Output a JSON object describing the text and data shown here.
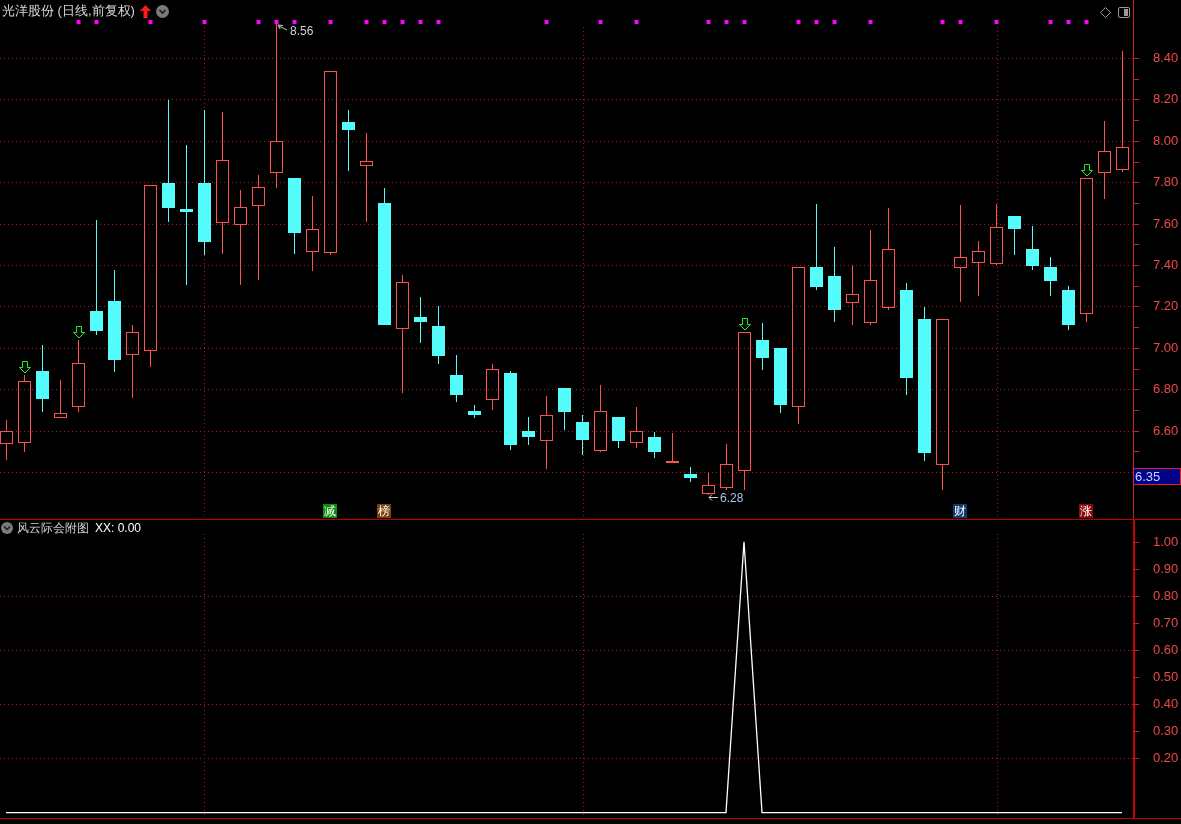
{
  "main_chart": {
    "title": "光洋股份 (日线,前复权)",
    "high_mark": "8.56",
    "low_mark": "6.28",
    "price_labels": [
      "8.40",
      "8.20",
      "8.00",
      "7.80",
      "7.60",
      "7.40",
      "7.20",
      "7.00",
      "6.80",
      "6.60"
    ],
    "current_price": "6.35",
    "event_tags": [
      {
        "label": "减",
        "color": "#108c10"
      },
      {
        "label": "榜",
        "color": "#7a420a"
      },
      {
        "label": "财",
        "color": "#0e3a6e"
      },
      {
        "label": "涨",
        "color": "#8c0a0a"
      }
    ]
  },
  "indicator": {
    "title": "风云际会附图",
    "readout": "XX: 0.00",
    "chart_data": {
      "type": "line",
      "grid": true,
      "series": [
        {
          "color": "#ffffff",
          "values": [
            0,
            0,
            0,
            0,
            0,
            0,
            0,
            0,
            0,
            0,
            0,
            0,
            0,
            0,
            0,
            0,
            0,
            0,
            0,
            0,
            0,
            0,
            0,
            0,
            0,
            0,
            0,
            0,
            0,
            0,
            0,
            0,
            0,
            0,
            0,
            0,
            0,
            0,
            0,
            0,
            0,
            1,
            0,
            0,
            0,
            0,
            0,
            0,
            0,
            0,
            0,
            0,
            0,
            0,
            0,
            0,
            0,
            0,
            0,
            0,
            0,
            0,
            0
          ]
        }
      ],
      "ylim": [
        -0.02,
        1.08
      ],
      "yticks": [
        {
          "value": 1.0,
          "label": "1.00"
        },
        {
          "value": 0.9,
          "label": "0.90"
        },
        {
          "value": 0.8,
          "label": "0.80"
        },
        {
          "value": 0.7,
          "label": "0.70"
        },
        {
          "value": 0.6,
          "label": "0.60"
        },
        {
          "value": 0.5,
          "label": "0.50"
        },
        {
          "value": 0.4,
          "label": "0.40"
        },
        {
          "value": 0.3,
          "label": "0.30"
        },
        {
          "value": 0.2,
          "label": "0.20"
        }
      ]
    }
  }
}
